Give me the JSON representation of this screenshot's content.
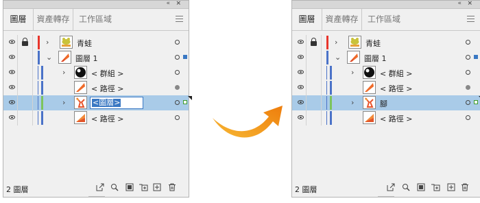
{
  "colors": {
    "accent_blue": "#3a78c3",
    "selection_bg": "#a9cbe8",
    "red_bar": "#e8352c",
    "blue_bar": "#4a72c8",
    "green_bar": "#7cc45c",
    "arrow_orange": "#f29a1f"
  },
  "panels": [
    {
      "id": "left",
      "titlebar": {
        "collapse": "«",
        "close": "×"
      },
      "tabs": [
        "圖層",
        "資產轉存",
        "工作區域"
      ],
      "rows": [
        {
          "label": "青蛙",
          "icon": "frog-thumbnail-icon",
          "bar": "red",
          "lock": true,
          "arrow": "›",
          "selected": false,
          "target": "hollow",
          "sel_square": ""
        },
        {
          "label": "圖層 1",
          "icon": "layer-thumbnail-icon",
          "bar": "blue",
          "lock": false,
          "arrow": "⌄",
          "selected": false,
          "target": "hollow",
          "sel_square": "blue"
        },
        {
          "label": "< 群組 >",
          "icon": "group-thumbnail-icon",
          "bar": "blue",
          "lock": false,
          "arrow": "›",
          "selected": false,
          "target": "hollow",
          "sel_square": ""
        },
        {
          "label": "< 路徑 >",
          "icon": "path-thumbnail-icon",
          "bar": "blue",
          "lock": false,
          "arrow": "",
          "selected": false,
          "target": "filled",
          "sel_square": ""
        },
        {
          "label": "<圖層>",
          "icon": "foot-thumbnail-icon",
          "bar": "green",
          "lock": false,
          "arrow": "›",
          "selected": true,
          "target": "hollow",
          "sel_square": "green",
          "editing": true
        },
        {
          "label": "< 路徑 >",
          "icon": "path2-thumbnail-icon",
          "bar": "blue",
          "lock": false,
          "arrow": "",
          "selected": false,
          "target": "hollow",
          "sel_square": ""
        }
      ],
      "footer": {
        "count": "2 圖層"
      }
    },
    {
      "id": "right",
      "titlebar": {
        "collapse": "«",
        "close": "×"
      },
      "tabs": [
        "圖層",
        "資產轉存",
        "工作區域"
      ],
      "rows": [
        {
          "label": "青蛙",
          "icon": "frog-thumbnail-icon",
          "bar": "red",
          "lock": true,
          "arrow": "›",
          "selected": false,
          "target": "hollow",
          "sel_square": ""
        },
        {
          "label": "圖層 1",
          "icon": "layer-thumbnail-icon",
          "bar": "blue",
          "lock": false,
          "arrow": "⌄",
          "selected": false,
          "target": "hollow",
          "sel_square": "blue"
        },
        {
          "label": "< 群組 >",
          "icon": "group-thumbnail-icon",
          "bar": "blue",
          "lock": false,
          "arrow": "›",
          "selected": false,
          "target": "hollow",
          "sel_square": ""
        },
        {
          "label": "< 路徑 >",
          "icon": "path-thumbnail-icon",
          "bar": "blue",
          "lock": false,
          "arrow": "",
          "selected": false,
          "target": "filled",
          "sel_square": ""
        },
        {
          "label": "腳",
          "icon": "foot-thumbnail-icon",
          "bar": "green",
          "lock": false,
          "arrow": "›",
          "selected": true,
          "target": "hollow",
          "sel_square": "green"
        },
        {
          "label": "< 路徑 >",
          "icon": "path2-thumbnail-icon",
          "bar": "blue",
          "lock": false,
          "arrow": "",
          "selected": false,
          "target": "hollow",
          "sel_square": ""
        }
      ],
      "footer": {
        "count": "2 圖層"
      }
    }
  ],
  "footer_icons": [
    "export-icon",
    "search-icon",
    "clipping-mask-icon",
    "new-sublayer-icon",
    "new-layer-icon",
    "trash-icon"
  ]
}
